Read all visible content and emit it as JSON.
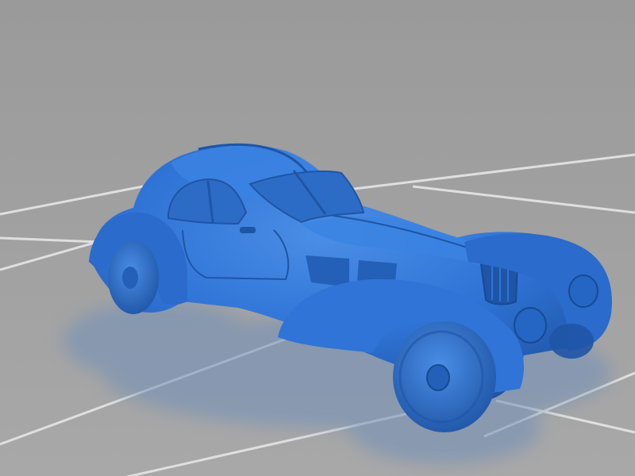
{
  "scene": {
    "subject": "car-model-render",
    "colors": {
      "background_top": "#9a9a9a",
      "background_bottom": "#a8a8a8",
      "floor_grid": "#e6e6e6",
      "model_main": "#2f74d6",
      "model_dark": "#1f55a6",
      "model_light": "#4a8ee6",
      "reflection": "#6f8fb9"
    },
    "icons": []
  }
}
